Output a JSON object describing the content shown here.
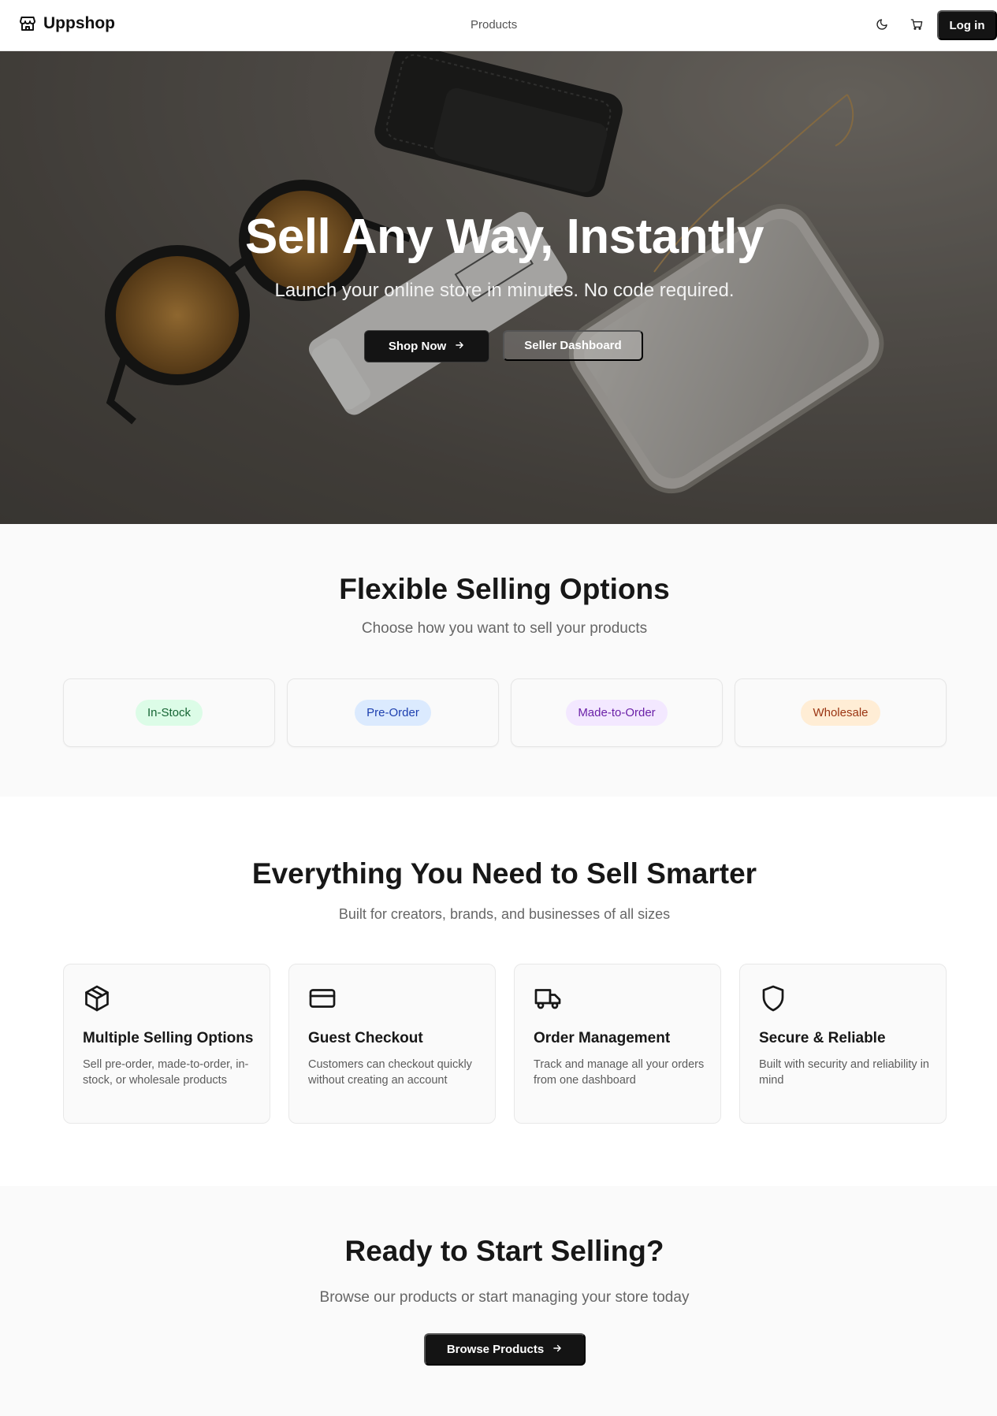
{
  "nav": {
    "brand": "Uppshop",
    "links": [
      "Products"
    ],
    "login_label": "Log in"
  },
  "hero": {
    "title": "Sell Any Way, Instantly",
    "subtitle": "Launch your online store in minutes. No code required.",
    "primary_button": "Shop Now",
    "secondary_button": "Seller Dashboard"
  },
  "selling_options": {
    "title": "Flexible Selling Options",
    "subtitle": "Choose how you want to sell your products",
    "options": [
      {
        "label": "In-Stock",
        "bg": "#dcfce7",
        "fg": "#166534"
      },
      {
        "label": "Pre-Order",
        "bg": "#dbeafe",
        "fg": "#1e40af"
      },
      {
        "label": "Made-to-Order",
        "bg": "#f3e8ff",
        "fg": "#6b21a8"
      },
      {
        "label": "Wholesale",
        "bg": "#ffedd5",
        "fg": "#9a3412"
      }
    ]
  },
  "features": {
    "title": "Everything You Need to Sell Smarter",
    "subtitle": "Built for creators, brands, and businesses of all sizes",
    "items": [
      {
        "icon": "package-icon",
        "title": "Multiple Selling Options",
        "description": "Sell pre-order, made-to-order, in-stock, or wholesale products"
      },
      {
        "icon": "credit-card-icon",
        "title": "Guest Checkout",
        "description": "Customers can checkout quickly without creating an account"
      },
      {
        "icon": "truck-icon",
        "title": "Order Management",
        "description": "Track and manage all your orders from one dashboard"
      },
      {
        "icon": "shield-icon",
        "title": "Secure & Reliable",
        "description": "Built with security and reliability in mind"
      }
    ]
  },
  "cta": {
    "title": "Ready to Start Selling?",
    "subtitle": "Browse our products or start managing your store today",
    "button": "Browse Products"
  }
}
